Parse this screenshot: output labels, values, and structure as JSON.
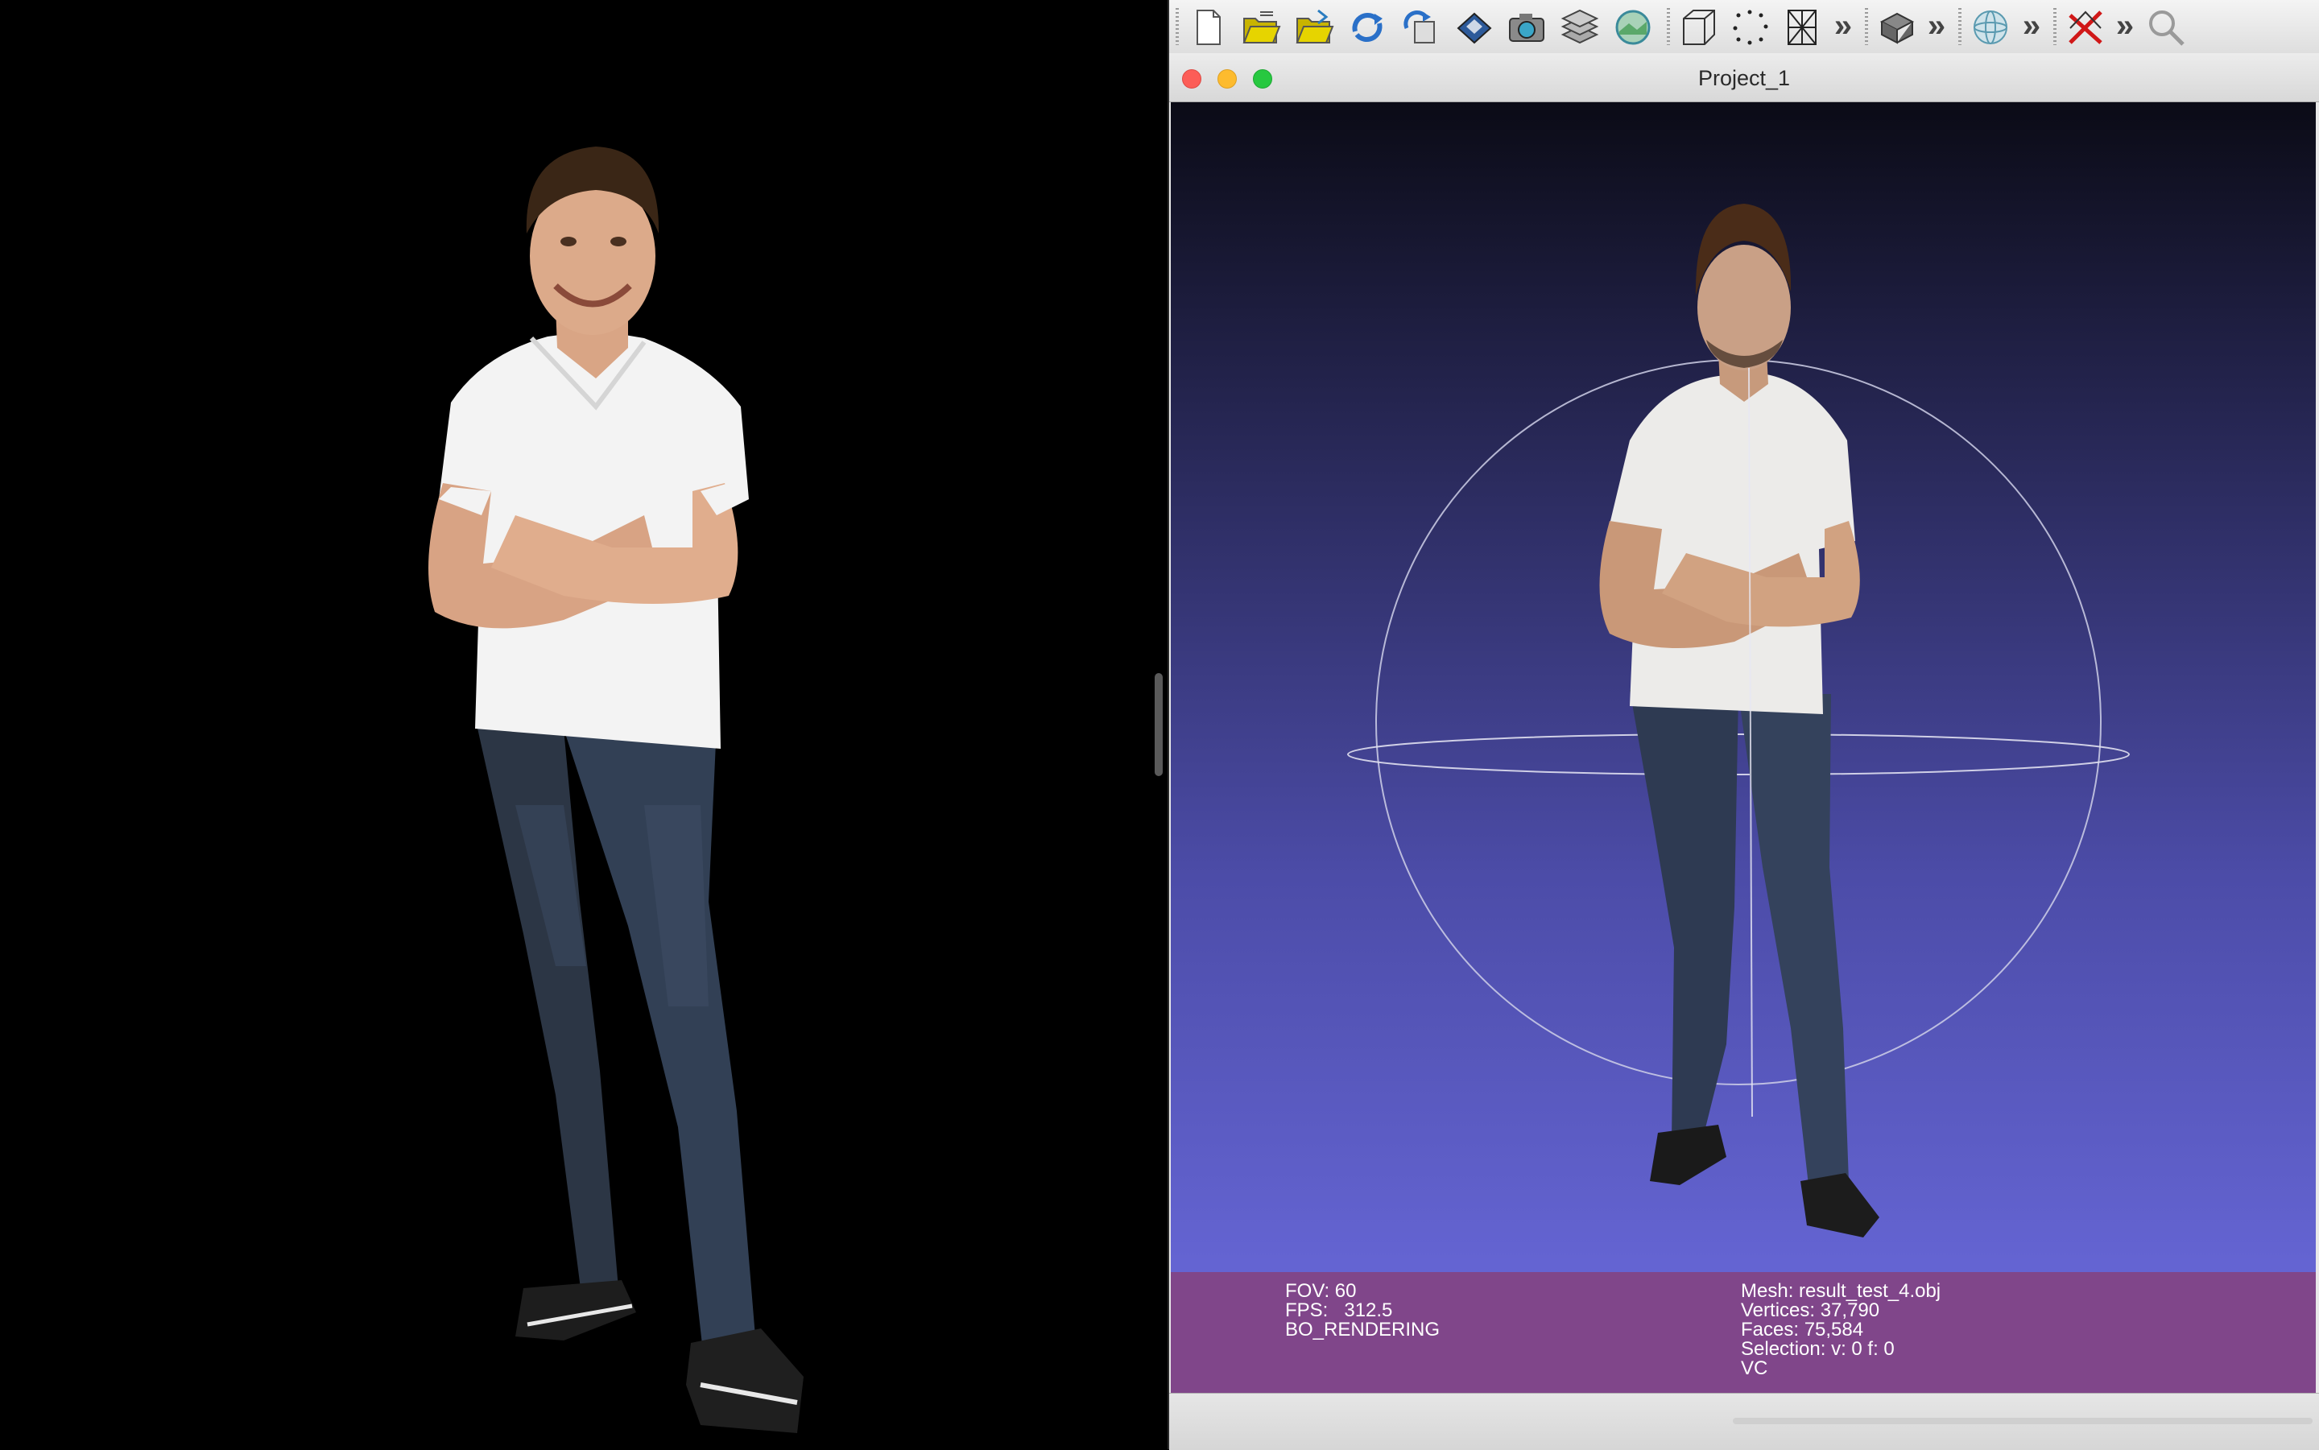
{
  "window": {
    "title": "Project_1"
  },
  "toolbar": {
    "buttons": [
      {
        "name": "new-project-icon"
      },
      {
        "name": "open-project-icon"
      },
      {
        "name": "import-mesh-icon"
      },
      {
        "name": "reload-icon"
      },
      {
        "name": "reload-all-icon"
      },
      {
        "name": "save-icon"
      },
      {
        "name": "snapshot-icon"
      },
      {
        "name": "layers-icon"
      },
      {
        "name": "raster-icon"
      }
    ],
    "render_buttons": [
      {
        "name": "bounding-box-icon"
      },
      {
        "name": "points-icon"
      },
      {
        "name": "wireframe-icon"
      }
    ],
    "more_glyph": "»"
  },
  "viewport": {
    "info_left": [
      "FOV: 60",
      "FPS:   312.5",
      "BO_RENDERING"
    ],
    "info_right": [
      "Mesh: result_test_4.obj",
      "Vertices: 37,790",
      "Faces: 75,584",
      "Selection: v: 0 f: 0",
      "VC"
    ]
  },
  "colors": {
    "info_bar": "#80468a",
    "viewport_top": "#0b0b16",
    "viewport_bottom": "#6c6ce0",
    "traffic_close": "#fc5d57",
    "traffic_minimize": "#fdbb2e",
    "traffic_zoom": "#27c840"
  }
}
